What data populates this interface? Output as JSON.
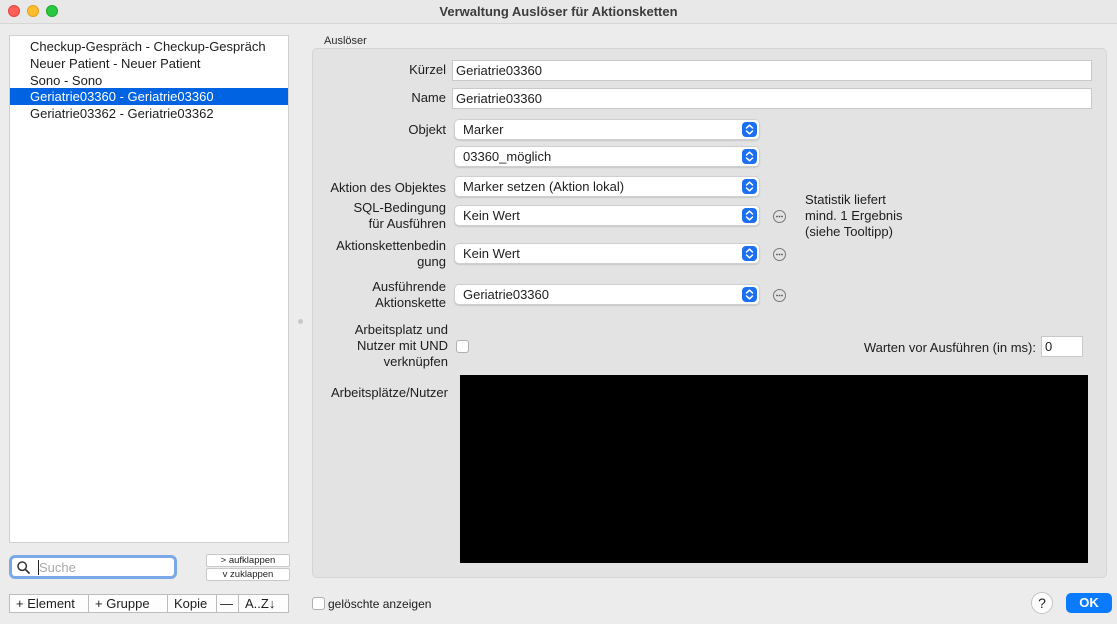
{
  "window": {
    "title": "Verwaltung Auslöser für Aktionsketten"
  },
  "list": {
    "items": [
      {
        "label": "Checkup-Gespräch - Checkup-Gespräch",
        "selected": false
      },
      {
        "label": "Neuer Patient - Neuer Patient",
        "selected": false
      },
      {
        "label": "Sono - Sono",
        "selected": false
      },
      {
        "label": "Geriatrie03360 - Geriatrie03360",
        "selected": true
      },
      {
        "label": "Geriatrie03362 - Geriatrie03362",
        "selected": false
      }
    ]
  },
  "search": {
    "placeholder": "Suche",
    "value": ""
  },
  "expand": {
    "expand_label": "> aufklappen",
    "collapse_label": "v  zuklappen"
  },
  "toolbar": {
    "add_element": "+ Element",
    "add_group": "+ Gruppe",
    "copy": "Kopie",
    "remove": "—",
    "sort": "A..Z↓"
  },
  "group": {
    "label": "Auslöser"
  },
  "form": {
    "kuerzel_label": "Kürzel",
    "kuerzel_value": "Geriatrie03360",
    "name_label": "Name",
    "name_value": "Geriatrie03360",
    "objekt_label": "Objekt",
    "objekt_value": "Marker",
    "objekt_sub_value": "03360_möglich",
    "aktion_label": "Aktion des Objektes",
    "aktion_value": "Marker setzen (Aktion lokal)",
    "sql_label_1": "SQL-Bedingung",
    "sql_label_2": "für Ausführen",
    "sql_value": "Kein Wert",
    "kette_bed_label_1": "Aktionskettenbedin",
    "kette_bed_label_2": "gung",
    "kette_bed_value": "Kein Wert",
    "ausf_label_1": "Ausführende",
    "ausf_label_2": "Aktionskette",
    "ausf_value": "Geriatrie03360",
    "arbeitsplatz_label_1": "Arbeitsplatz und",
    "arbeitsplatz_label_2": "Nutzer mit UND",
    "arbeitsplatz_label_3": "verknüpfen",
    "arbeitsplatz_checked": false,
    "warten_label": "Warten vor Ausführen (in ms):",
    "warten_value": "0",
    "arbeitsplaetze_label": "Arbeitsplätze/Nutzer",
    "note_1": "Statistik liefert",
    "note_2": "mind. 1 Ergebnis",
    "note_3": "(siehe Tooltipp)"
  },
  "footer": {
    "show_deleted_label": "gelöschte anzeigen",
    "show_deleted_checked": false,
    "help_label": "?",
    "ok_label": "OK"
  },
  "colors": {
    "selection": "#0063e1",
    "accent": "#0a7bff"
  }
}
